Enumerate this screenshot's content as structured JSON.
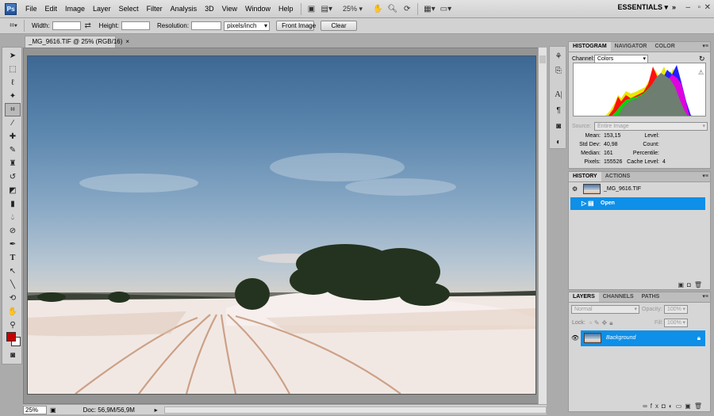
{
  "menubar": {
    "logo": "Ps",
    "items": [
      "File",
      "Edit",
      "Image",
      "Layer",
      "Select",
      "Filter",
      "Analysis",
      "3D",
      "View",
      "Window",
      "Help"
    ],
    "zoom": "25%",
    "workspace": "ESSENTIALS"
  },
  "options": {
    "width_label": "Width:",
    "height_label": "Height:",
    "resolution_label": "Resolution:",
    "resolution_unit": "pixels/inch",
    "front_image_label": "Front Image",
    "clear_label": "Clear"
  },
  "document": {
    "tab_title": "_MG_9616.TIF @ 25% (RGB/16)",
    "tab_close": "×",
    "zoom": "25%",
    "doc_size": "Doc: 56,9M/56,9M"
  },
  "histogram_panel": {
    "tabs": [
      "HISTOGRAM",
      "NAVIGATOR",
      "COLOR"
    ],
    "channel_label": "Channel:",
    "channel_value": "Colors",
    "warning": "⚠",
    "source_label": "Source:",
    "source_value": "Entire Image",
    "stats_left": [
      {
        "label": "Mean:",
        "value": "153,15"
      },
      {
        "label": "Std Dev:",
        "value": "40,98"
      },
      {
        "label": "Median:",
        "value": "161"
      },
      {
        "label": "Pixels:",
        "value": "155526"
      }
    ],
    "stats_right": [
      {
        "label": "Level:",
        "value": ""
      },
      {
        "label": "Count:",
        "value": ""
      },
      {
        "label": "Percentile:",
        "value": ""
      },
      {
        "label": "Cache Level:",
        "value": "4"
      }
    ]
  },
  "history_panel": {
    "tabs": [
      "HISTORY",
      "ACTIONS"
    ],
    "snapshot": "_MG_9616.TIF",
    "items": [
      "Open"
    ]
  },
  "layers_panel": {
    "tabs": [
      "LAYERS",
      "CHANNELS",
      "PATHS"
    ],
    "blend_mode": "Normal",
    "opacity_label": "Opacity:",
    "opacity_value": "100%",
    "lock_label": "Lock:",
    "fill_label": "Fill:",
    "fill_value": "100%",
    "layer_name": "Background"
  },
  "colors": {
    "accent": "#0e8fe8",
    "foreground": "#c80000",
    "background": "#ffffff"
  }
}
